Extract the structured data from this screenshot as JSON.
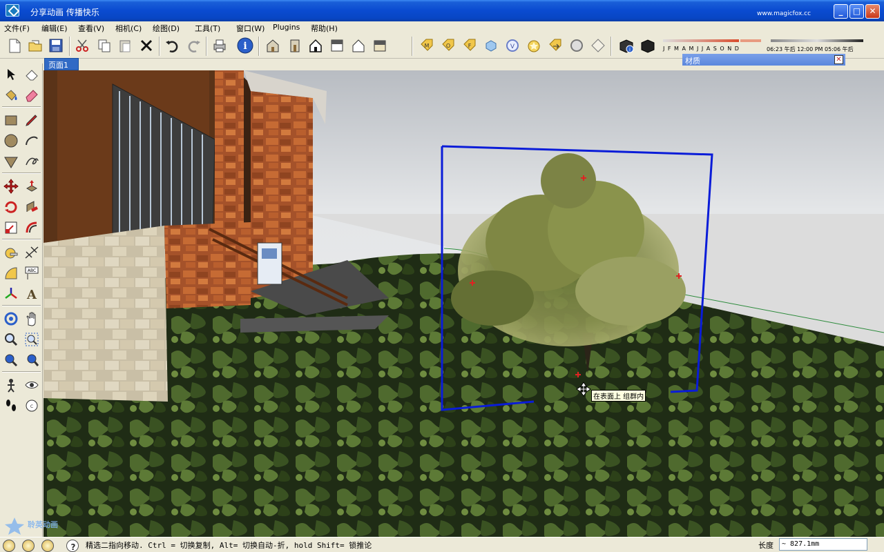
{
  "window": {
    "title": "分享动画 传播快乐",
    "site": "www.magicfox.cc",
    "minimize": "_",
    "maximize": "□",
    "close": "✕"
  },
  "menu": [
    {
      "label": "文件(F)"
    },
    {
      "label": "编辑(E)"
    },
    {
      "label": "查看(V)"
    },
    {
      "label": "相机(C)"
    },
    {
      "label": "绘图(D)"
    },
    {
      "label": "工具(T)"
    },
    {
      "label": "窗口(W)"
    },
    {
      "label": "Plugins"
    },
    {
      "label": "帮助(H)"
    }
  ],
  "toolbar_icons": [
    "new-file-icon",
    "open-folder-icon",
    "save-icon",
    "cut-icon",
    "copy-icon",
    "paste-icon",
    "delete-icon",
    "undo-icon",
    "redo-icon",
    "print-icon",
    "model-info-icon",
    "house-iso-icon",
    "house-front-icon",
    "house-top-icon",
    "house-side-icon",
    "house-outline-icon",
    "house-back-icon",
    "tag-m-icon",
    "tag-o-icon",
    "tag-f-icon",
    "cube-icon",
    "v-ring-icon",
    "star-tag-icon",
    "tag-arrow-icon",
    "circle-icon",
    "diamond-icon",
    "shadow-settings-icon",
    "shadow-toggle-icon"
  ],
  "shadow": {
    "months": "J F M A M J J A S O N D",
    "time_row": "06:23 午后   12:00 PM   05:06 午后"
  },
  "page_tab": "页面1",
  "material_panel": {
    "title": "材质",
    "close": "✕"
  },
  "left_tools": [
    "select-icon",
    "eraser-icon",
    "paint-bucket-icon",
    "eraser-pink-icon",
    "rectangle-icon",
    "pencil-icon",
    "circle-tool-icon",
    "arc-icon",
    "polygon-icon",
    "freehand-icon",
    "move-icon",
    "push-pull-icon",
    "rotate-icon",
    "follow-me-icon",
    "scale-icon",
    "offset-icon",
    "tape-measure-icon",
    "dimension-icon",
    "protractor-icon",
    "text-icon",
    "axes-icon",
    "3d-text-icon",
    "orbit-icon",
    "pan-icon",
    "zoom-icon",
    "zoom-window-icon",
    "zoom-extents-icon",
    "previous-view-icon",
    "position-camera-icon",
    "look-around-icon",
    "walk-icon",
    "section-plane-icon"
  ],
  "tooltip": "在表面上  组群内",
  "status": {
    "text": "精选二指向移动.  Ctrl = 切换复制, Alt= 切换自动-折, hold Shift= 锁推论",
    "length_label": "长度",
    "length_value": "~ 827.1mm"
  },
  "watermark": "聆英动画"
}
